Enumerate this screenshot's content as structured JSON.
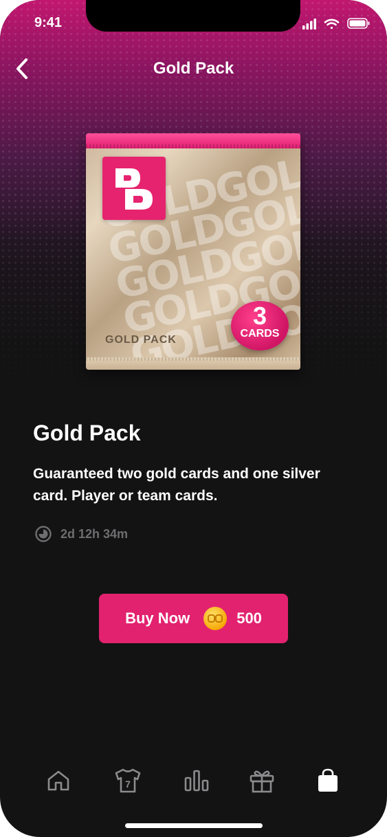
{
  "status_bar": {
    "time": "9:41"
  },
  "nav": {
    "title": "Gold Pack"
  },
  "pack": {
    "name": "GOLD PACK",
    "pattern_word": "GOLD",
    "badge_number": "3",
    "badge_label": "CARDS"
  },
  "product": {
    "title": "Gold Pack",
    "description": "Guaranteed two gold cards and one silver card. Player or team cards.",
    "time_remaining": "2d 12h 34m"
  },
  "buy": {
    "label": "Buy Now",
    "price": "500"
  },
  "tabs": [
    {
      "icon": "home-icon",
      "active": false
    },
    {
      "icon": "jersey-icon",
      "active": false,
      "jersey_number": "7"
    },
    {
      "icon": "leaderboard-icon",
      "active": false
    },
    {
      "icon": "gift-icon",
      "active": false
    },
    {
      "icon": "shopping-bag-icon",
      "active": true
    }
  ],
  "colors": {
    "accent": "#E2226F",
    "background": "#141314",
    "muted": "#6E6D6F",
    "coin": "#F5A500"
  }
}
